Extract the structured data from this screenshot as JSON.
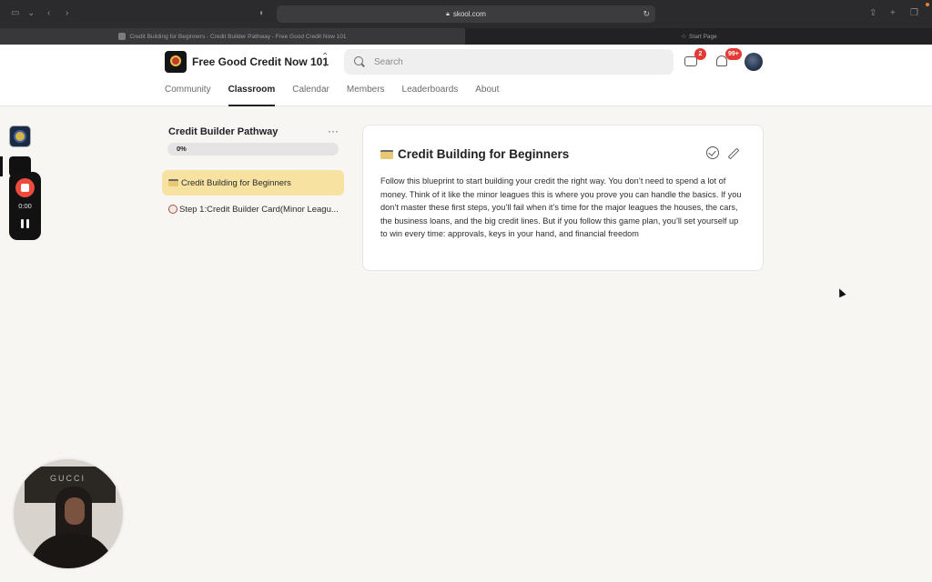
{
  "browser": {
    "url": "skool.com",
    "active_tab": "Credit Building for Beginners - Credit Builder Pathway - Free Good Credit Now 101",
    "inactive_tab": "Start Page"
  },
  "header": {
    "group_name": "Free Good Credit Now 101",
    "search_placeholder": "Search",
    "chat_badge": "2",
    "notification_badge": "99+"
  },
  "nav": {
    "tabs": [
      {
        "label": "Community",
        "active": false
      },
      {
        "label": "Classroom",
        "active": true
      },
      {
        "label": "Calendar",
        "active": false
      },
      {
        "label": "Members",
        "active": false
      },
      {
        "label": "Leaderboards",
        "active": false
      },
      {
        "label": "About",
        "active": false
      }
    ]
  },
  "recorder": {
    "time": "0:00"
  },
  "course": {
    "title": "Credit Builder Pathway",
    "more": "···",
    "progress_percent": 0,
    "progress_label": "0%",
    "lessons": [
      {
        "label": "Credit Building for Beginners",
        "icon": "credit-card-emoji",
        "active": true
      },
      {
        "label": "Step 1:Credit Builder Card(Minor Leagu...",
        "icon": "baseball-emoji",
        "active": false
      }
    ]
  },
  "lesson": {
    "title": "Credit Building for Beginners",
    "body": "Follow this blueprint to start building your credit the right way. You don’t need to spend a lot of money. Think of it like the minor leagues this is where you prove you can handle the basics. If you don’t master these first steps, you’ll fail when it’s time for the major leagues the houses, the cars, the business loans, and the big credit lines. But if you follow this game plan, you’ll set yourself up to win every time: approvals, keys in your hand, and financial freedom"
  },
  "webcam": {
    "sign_text": "GUCCI"
  }
}
